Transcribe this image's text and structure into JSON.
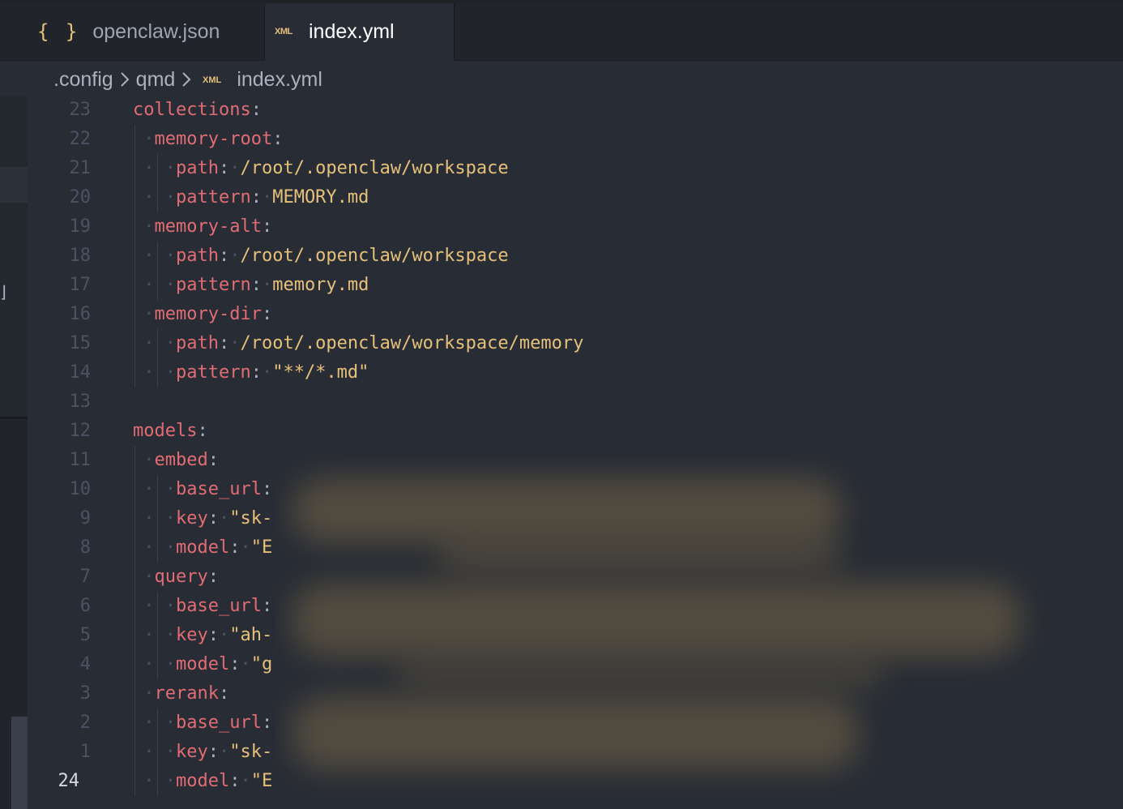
{
  "tabs": [
    {
      "icon": "{ }",
      "label": "openclaw.json",
      "active": false
    },
    {
      "icon": "XML",
      "label": "index.yml",
      "active": true
    }
  ],
  "breadcrumb": [
    ".config",
    "qmd",
    "index.yml"
  ],
  "editor": {
    "lines": [
      {
        "ln": "23",
        "indent": 0,
        "tokens": [
          {
            "c": "k",
            "t": "collections"
          },
          {
            "c": "p",
            "t": ":"
          }
        ]
      },
      {
        "ln": "22",
        "indent": 1,
        "tokens": [
          {
            "c": "k",
            "t": "memory-root"
          },
          {
            "c": "p",
            "t": ":"
          }
        ]
      },
      {
        "ln": "21",
        "indent": 2,
        "tokens": [
          {
            "c": "k",
            "t": "path"
          },
          {
            "c": "p",
            "t": ":"
          },
          {
            "c": "w",
            "t": "·"
          },
          {
            "c": "s",
            "t": "/root/.openclaw/workspace"
          }
        ]
      },
      {
        "ln": "20",
        "indent": 2,
        "tokens": [
          {
            "c": "k",
            "t": "pattern"
          },
          {
            "c": "p",
            "t": ":"
          },
          {
            "c": "w",
            "t": "·"
          },
          {
            "c": "s",
            "t": "MEMORY.md"
          }
        ]
      },
      {
        "ln": "19",
        "indent": 1,
        "tokens": [
          {
            "c": "k",
            "t": "memory-alt"
          },
          {
            "c": "p",
            "t": ":"
          }
        ]
      },
      {
        "ln": "18",
        "indent": 2,
        "tokens": [
          {
            "c": "k",
            "t": "path"
          },
          {
            "c": "p",
            "t": ":"
          },
          {
            "c": "w",
            "t": "·"
          },
          {
            "c": "s",
            "t": "/root/.openclaw/workspace"
          }
        ]
      },
      {
        "ln": "17",
        "indent": 2,
        "tokens": [
          {
            "c": "k",
            "t": "pattern"
          },
          {
            "c": "p",
            "t": ":"
          },
          {
            "c": "w",
            "t": "·"
          },
          {
            "c": "s",
            "t": "memory.md"
          }
        ]
      },
      {
        "ln": "16",
        "indent": 1,
        "tokens": [
          {
            "c": "k",
            "t": "memory-dir"
          },
          {
            "c": "p",
            "t": ":"
          }
        ]
      },
      {
        "ln": "15",
        "indent": 2,
        "tokens": [
          {
            "c": "k",
            "t": "path"
          },
          {
            "c": "p",
            "t": ":"
          },
          {
            "c": "w",
            "t": "·"
          },
          {
            "c": "s",
            "t": "/root/.openclaw/workspace/memory"
          }
        ]
      },
      {
        "ln": "14",
        "indent": 2,
        "tokens": [
          {
            "c": "k",
            "t": "pattern"
          },
          {
            "c": "p",
            "t": ":"
          },
          {
            "c": "w",
            "t": "·"
          },
          {
            "c": "s",
            "t": "\"**/*.md\""
          }
        ]
      },
      {
        "ln": "13",
        "indent": 0,
        "tokens": []
      },
      {
        "ln": "12",
        "indent": 0,
        "tokens": [
          {
            "c": "k",
            "t": "models"
          },
          {
            "c": "p",
            "t": ":"
          }
        ]
      },
      {
        "ln": "11",
        "indent": 1,
        "tokens": [
          {
            "c": "k",
            "t": "embed"
          },
          {
            "c": "p",
            "t": ":"
          }
        ]
      },
      {
        "ln": "10",
        "indent": 2,
        "tokens": [
          {
            "c": "k",
            "t": "base_url"
          },
          {
            "c": "p",
            "t": ":"
          }
        ]
      },
      {
        "ln": "9",
        "indent": 2,
        "tokens": [
          {
            "c": "k",
            "t": "key"
          },
          {
            "c": "p",
            "t": ":"
          },
          {
            "c": "w",
            "t": "·"
          },
          {
            "c": "s",
            "t": "\"sk-"
          }
        ]
      },
      {
        "ln": "8",
        "indent": 2,
        "tokens": [
          {
            "c": "k",
            "t": "model"
          },
          {
            "c": "p",
            "t": ":"
          },
          {
            "c": "w",
            "t": "·"
          },
          {
            "c": "s",
            "t": "\"E"
          }
        ]
      },
      {
        "ln": "7",
        "indent": 1,
        "tokens": [
          {
            "c": "k",
            "t": "query"
          },
          {
            "c": "p",
            "t": ":"
          }
        ]
      },
      {
        "ln": "6",
        "indent": 2,
        "tokens": [
          {
            "c": "k",
            "t": "base_url"
          },
          {
            "c": "p",
            "t": ":"
          }
        ]
      },
      {
        "ln": "5",
        "indent": 2,
        "tokens": [
          {
            "c": "k",
            "t": "key"
          },
          {
            "c": "p",
            "t": ":"
          },
          {
            "c": "w",
            "t": "·"
          },
          {
            "c": "s",
            "t": "\"ah-"
          }
        ]
      },
      {
        "ln": "4",
        "indent": 2,
        "tokens": [
          {
            "c": "k",
            "t": "model"
          },
          {
            "c": "p",
            "t": ":"
          },
          {
            "c": "w",
            "t": "·"
          },
          {
            "c": "s",
            "t": "\"g"
          }
        ]
      },
      {
        "ln": "3",
        "indent": 1,
        "tokens": [
          {
            "c": "k",
            "t": "rerank"
          },
          {
            "c": "p",
            "t": ":"
          }
        ]
      },
      {
        "ln": "2",
        "indent": 2,
        "tokens": [
          {
            "c": "k",
            "t": "base_url"
          },
          {
            "c": "p",
            "t": ":"
          }
        ]
      },
      {
        "ln": "1",
        "indent": 2,
        "tokens": [
          {
            "c": "k",
            "t": "key"
          },
          {
            "c": "p",
            "t": ":"
          },
          {
            "c": "w",
            "t": "·"
          },
          {
            "c": "s",
            "t": "\"sk-"
          }
        ]
      },
      {
        "ln": "24",
        "indent": 2,
        "current": true,
        "tokens": [
          {
            "c": "k",
            "t": "model"
          },
          {
            "c": "p",
            "t": ":"
          },
          {
            "c": "w",
            "t": "·"
          },
          {
            "c": "s",
            "t": "\"E"
          }
        ]
      }
    ]
  },
  "colors": {
    "background": "#282c34",
    "key": "#e06c75",
    "string": "#e5c07b",
    "punctuation": "#abb2bf",
    "line_number": "#4b5263",
    "current_line_number": "#d7dae0"
  },
  "redacted": true
}
